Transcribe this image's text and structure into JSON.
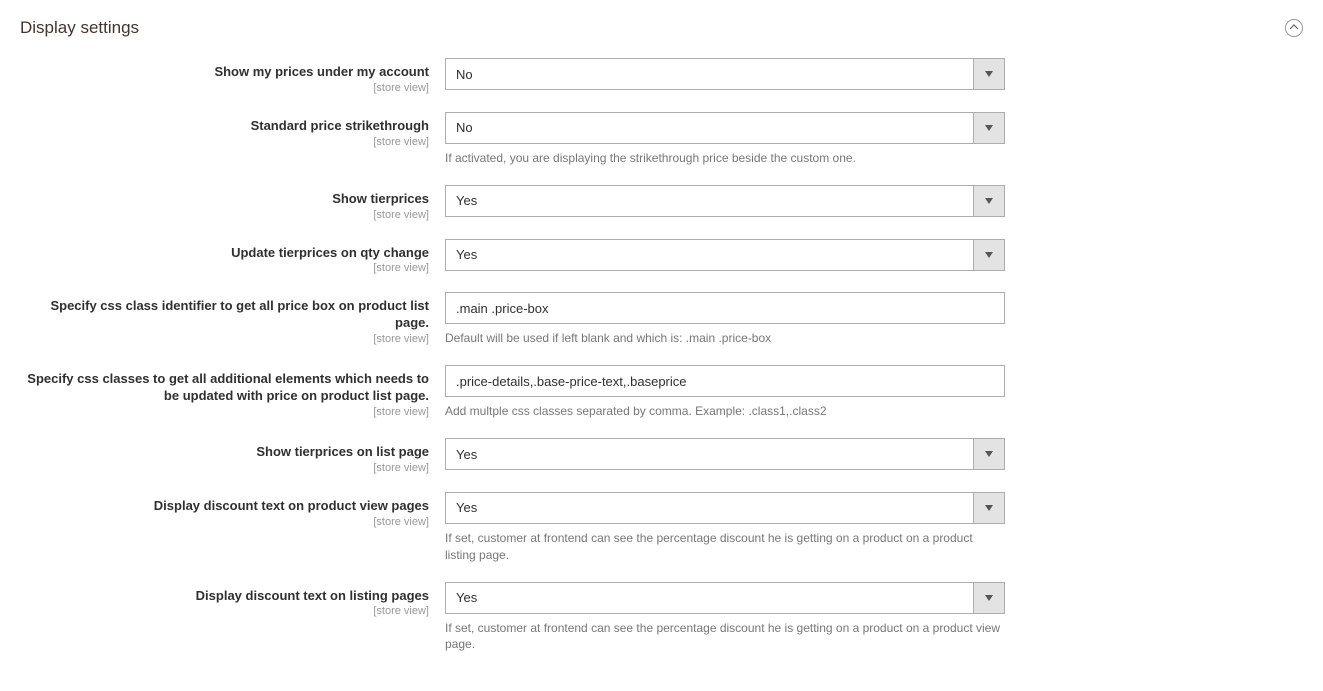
{
  "section": {
    "title": "Display settings"
  },
  "scope": "[store view]",
  "fields": {
    "show_prices": {
      "label": "Show my prices under my account",
      "value": "No"
    },
    "strikethrough": {
      "label": "Standard price strikethrough",
      "value": "No",
      "help": "If activated, you are displaying the strikethrough price beside the custom one."
    },
    "show_tierprices": {
      "label": "Show tierprices",
      "value": "Yes"
    },
    "update_tierprices": {
      "label": "Update tierprices on qty change",
      "value": "Yes"
    },
    "css_pricebox": {
      "label": "Specify css class identifier to get all price box on product list page.",
      "value": ".main .price-box",
      "help": "Default will be used if left blank and which is: .main .price-box"
    },
    "css_additional": {
      "label": "Specify css classes to get all additional elements which needs to be updated with price on product list page.",
      "value": ".price-details,.base-price-text,.baseprice",
      "help": "Add multple css classes separated by comma. Example: .class1,.class2"
    },
    "tierprices_list": {
      "label": "Show tierprices on list page",
      "value": "Yes"
    },
    "discount_view": {
      "label": "Display discount text on product view pages",
      "value": "Yes",
      "help": "If set, customer at frontend can see the percentage discount he is getting on a product on a product listing page."
    },
    "discount_listing": {
      "label": "Display discount text on listing pages",
      "value": "Yes",
      "help": "If set, customer at frontend can see the percentage discount he is getting on a product on a product view page."
    }
  }
}
